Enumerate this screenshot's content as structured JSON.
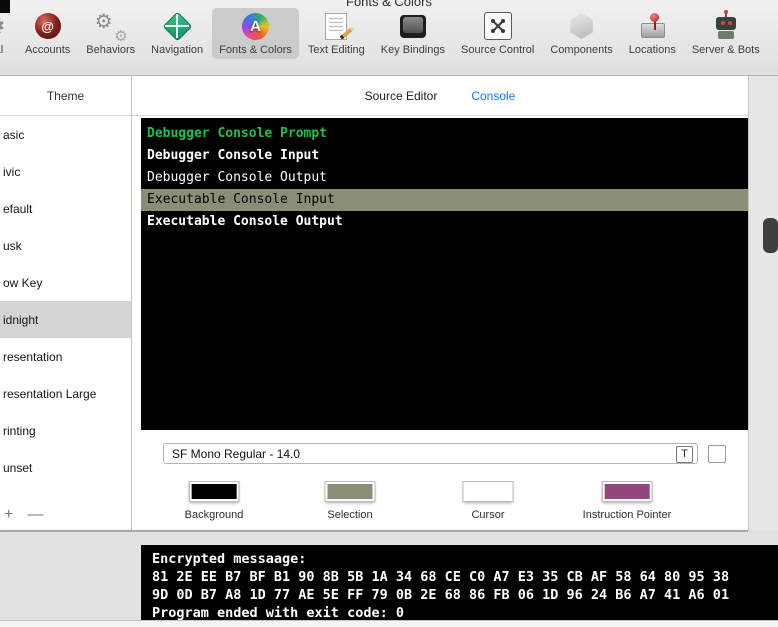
{
  "window": {
    "title": "Fonts & Colors"
  },
  "toolbar": {
    "items": [
      {
        "label": "eral",
        "icon": "gear-icon",
        "selected": false
      },
      {
        "label": "Accounts",
        "icon": "at-icon",
        "selected": false
      },
      {
        "label": "Behaviors",
        "icon": "gears-icon",
        "selected": false
      },
      {
        "label": "Navigation",
        "icon": "navigation-icon",
        "selected": false
      },
      {
        "label": "Fonts & Colors",
        "icon": "fonts-colors-icon",
        "selected": true
      },
      {
        "label": "Text Editing",
        "icon": "text-editing-icon",
        "selected": false
      },
      {
        "label": "Key Bindings",
        "icon": "keycap-icon",
        "selected": false
      },
      {
        "label": "Source Control",
        "icon": "source-control-icon",
        "selected": false
      },
      {
        "label": "Components",
        "icon": "components-icon",
        "selected": false
      },
      {
        "label": "Locations",
        "icon": "locations-icon",
        "selected": false
      },
      {
        "label": "Server & Bots",
        "icon": "robot-icon",
        "selected": false
      }
    ]
  },
  "sidebar": {
    "header": "Theme",
    "items": [
      {
        "label": "asic",
        "selected": false
      },
      {
        "label": "ivic",
        "selected": false
      },
      {
        "label": "efault",
        "selected": false
      },
      {
        "label": "usk",
        "selected": false
      },
      {
        "label": "ow Key",
        "selected": false
      },
      {
        "label": "idnight",
        "selected": true
      },
      {
        "label": "resentation",
        "selected": false
      },
      {
        "label": "resentation Large",
        "selected": false
      },
      {
        "label": "rinting",
        "selected": false
      },
      {
        "label": "unset",
        "selected": false
      }
    ],
    "add_label": "+",
    "remove_label": "—"
  },
  "tabs": {
    "source_editor": "Source Editor",
    "console": "Console",
    "active": "Console"
  },
  "preview": {
    "rows": [
      {
        "text": "Debugger Console Prompt",
        "color": "#1DC24B",
        "bold": true,
        "selected": false
      },
      {
        "text": "Debugger Console Input",
        "color": "#FFFFFF",
        "bold": true,
        "selected": false
      },
      {
        "text": "Debugger Console Output",
        "color": "#FFFFFF",
        "bold": false,
        "selected": false
      },
      {
        "text": "Executable Console Input",
        "color": "#000000",
        "bold": false,
        "selected": true,
        "selection_bg": "#8C8C77"
      },
      {
        "text": "Executable Console Output",
        "color": "#FFFFFF",
        "bold": true,
        "selected": false
      }
    ]
  },
  "font_field": {
    "value": "SF Mono Regular - 14.0",
    "t_button": "T"
  },
  "swatches": [
    {
      "label": "Background",
      "color": "#000000"
    },
    {
      "label": "Selection",
      "color": "#8C8C77"
    },
    {
      "label": "Cursor",
      "color": "#FFFFFF"
    },
    {
      "label": "Instruction Pointer",
      "color": "#91477C"
    }
  ],
  "console_output": {
    "lines": [
      "Encrypted messaage:",
      "81 2E EE B7 BF B1 90 8B 5B 1A 34 68 CE C0 A7 E3 35 CB AF 58 64 80 95 38",
      "9D 0D B7 A8 1D 77 AE 5E FF 79 0B 2E 68 86 FB 06 1D 96 24 B6 A7 41 A6 01",
      "Program ended with exit code: 0"
    ]
  },
  "colors": {
    "accent_blue": "#0A7AFF",
    "prompt_green": "#1DC24B",
    "selection_olive": "#8C8C77",
    "instruction_pointer_plum": "#91477C"
  }
}
